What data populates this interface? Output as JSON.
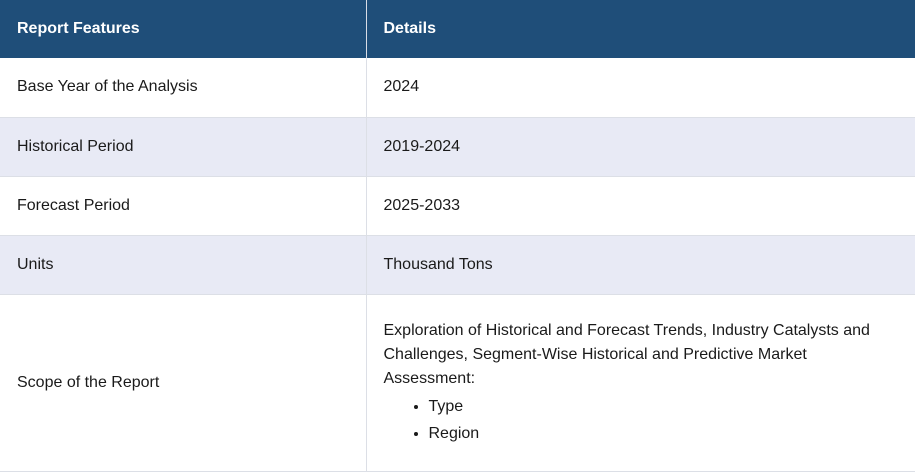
{
  "table": {
    "headers": [
      "Report Features",
      "Details"
    ],
    "rows": [
      {
        "feature": "Base Year of the Analysis",
        "detail": "2024"
      },
      {
        "feature": "Historical Period",
        "detail": "2019-2024"
      },
      {
        "feature": "Forecast Period",
        "detail": "2025-2033"
      },
      {
        "feature": "Units",
        "detail": "Thousand Tons"
      }
    ],
    "scope": {
      "feature": "Scope of the Report",
      "detail": "Exploration of Historical and Forecast Trends, Industry Catalysts and Challenges, Segment-Wise Historical and Predictive Market Assessment:",
      "items": [
        "Type",
        "Region"
      ]
    }
  }
}
